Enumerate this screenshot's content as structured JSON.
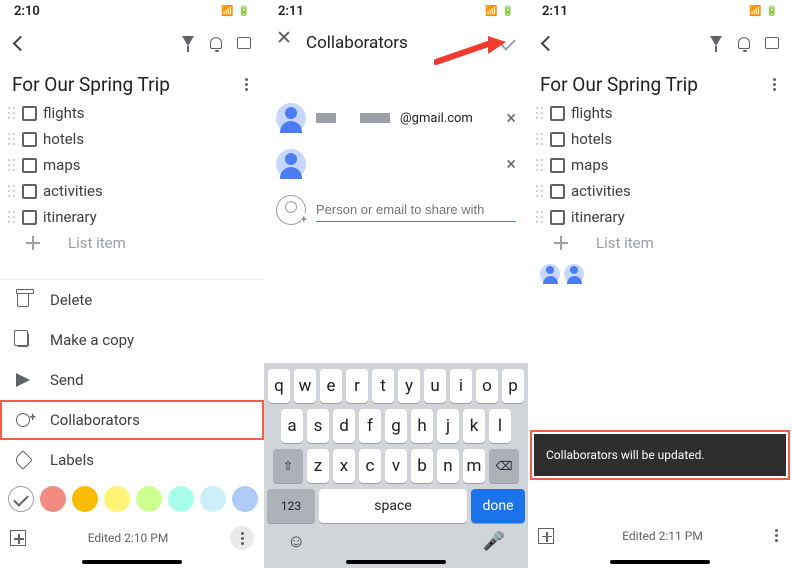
{
  "panel1": {
    "status_time": "2:10",
    "note_title": "For Our Spring Trip",
    "checklist": [
      "flights",
      "hotels",
      "maps",
      "activities",
      "itinerary"
    ],
    "list_placeholder": "List item",
    "sheet": {
      "delete": "Delete",
      "copy": "Make a copy",
      "send": "Send",
      "collab": "Collaborators",
      "labels": "Labels"
    },
    "colors": [
      "#ffffff",
      "#f28b82",
      "#fbbc04",
      "#fff475",
      "#ccff90",
      "#a7ffeb",
      "#cbf0f8",
      "#aecbfa"
    ],
    "footer_time": "Edited 2:10 PM"
  },
  "panel2": {
    "status_time": "2:11",
    "title": "Collaborators",
    "row1_suffix": "@gmail.com",
    "add_placeholder": "Person or email to share with",
    "keys_r1": [
      "q",
      "w",
      "e",
      "r",
      "t",
      "y",
      "u",
      "i",
      "o",
      "p"
    ],
    "keys_r2": [
      "a",
      "s",
      "d",
      "f",
      "g",
      "h",
      "j",
      "k",
      "l"
    ],
    "keys_r3": [
      "z",
      "x",
      "c",
      "v",
      "b",
      "n",
      "m"
    ],
    "key_123": "123",
    "key_space": "space",
    "key_done": "done"
  },
  "panel3": {
    "status_time": "2:11",
    "note_title": "For Our Spring Trip",
    "checklist": [
      "flights",
      "hotels",
      "maps",
      "activities",
      "itinerary"
    ],
    "list_placeholder": "List item",
    "toast": "Collaborators will be updated.",
    "footer_time": "Edited 2:11 PM"
  }
}
